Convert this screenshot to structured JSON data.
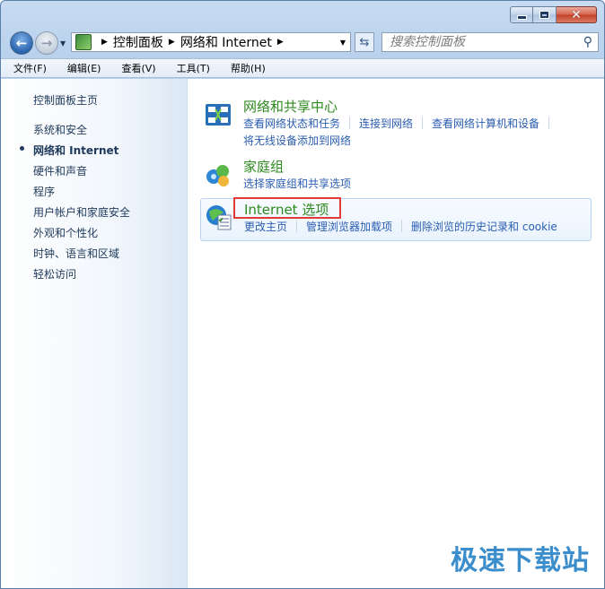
{
  "window": {
    "controls": {
      "minimize": "minimize",
      "maximize": "maximize",
      "close": "close"
    }
  },
  "navbar": {
    "breadcrumb": [
      "控制面板",
      "网络和 Internet"
    ],
    "search_placeholder": "搜索控制面板"
  },
  "menu": [
    "文件(F)",
    "编辑(E)",
    "查看(V)",
    "工具(T)",
    "帮助(H)"
  ],
  "sidebar": {
    "items": [
      {
        "label": "控制面板主页",
        "current": false
      },
      {
        "label": "系统和安全",
        "current": false
      },
      {
        "label": "网络和 Internet",
        "current": true
      },
      {
        "label": "硬件和声音",
        "current": false
      },
      {
        "label": "程序",
        "current": false
      },
      {
        "label": "用户帐户和家庭安全",
        "current": false
      },
      {
        "label": "外观和个性化",
        "current": false
      },
      {
        "label": "时钟、语言和区域",
        "current": false
      },
      {
        "label": "轻松访问",
        "current": false
      }
    ]
  },
  "categories": [
    {
      "title": "网络和共享中心",
      "icon": "network-sharing-center-icon",
      "links": [
        "查看网络状态和任务",
        "连接到网络",
        "查看网络计算机和设备"
      ],
      "links2": [
        "将无线设备添加到网络"
      ]
    },
    {
      "title": "家庭组",
      "icon": "homegroup-icon",
      "links": [
        "选择家庭组和共享选项"
      ]
    },
    {
      "title": "Internet 选项",
      "icon": "internet-options-icon",
      "links": [
        "更改主页",
        "管理浏览器加载项",
        "删除浏览的历史记录和 cookie"
      ]
    }
  ],
  "watermark": "极速下载站",
  "colors": {
    "link": "#2a5db0",
    "category_title": "#2e8a1f",
    "highlight_box": "#e03a3a"
  }
}
